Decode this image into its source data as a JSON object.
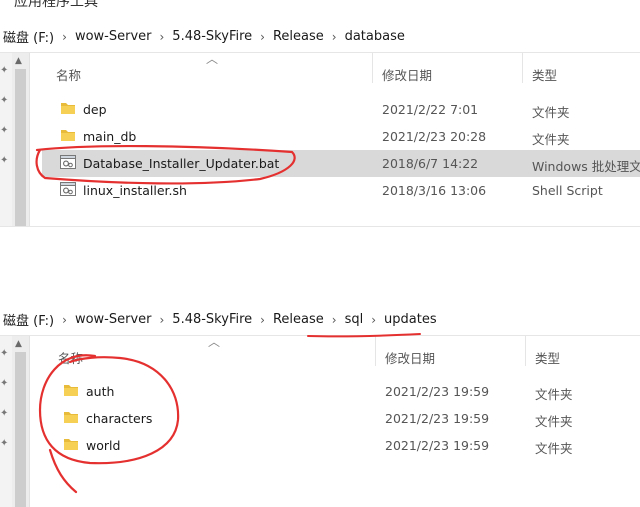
{
  "window_title": "应用程序工具",
  "colors": {
    "folder": "#e8bb3a",
    "selected_row": "#d9d9d9",
    "annotation": "#e53030"
  },
  "top_pane": {
    "breadcrumb": [
      "磁盘 (F:)",
      "wow-Server",
      "5.48-SkyFire",
      "Release",
      "database"
    ],
    "columns": {
      "name": "名称",
      "date": "修改日期",
      "type": "类型"
    },
    "rows": [
      {
        "name": "dep",
        "date": "2021/2/22 7:01",
        "type": "文件夹",
        "icon": "folder-icon"
      },
      {
        "name": "main_db",
        "date": "2021/2/23 20:28",
        "type": "文件夹",
        "icon": "folder-icon"
      },
      {
        "name": "Database_Installer_Updater.bat",
        "date": "2018/6/7 14:22",
        "type": "Windows 批处理文件",
        "icon": "batch-file-icon",
        "selected": true
      },
      {
        "name": "linux_installer.sh",
        "date": "2018/3/16 13:06",
        "type": "Shell Script",
        "icon": "script-file-icon"
      }
    ]
  },
  "bottom_pane": {
    "breadcrumb": [
      "磁盘 (F:)",
      "wow-Server",
      "5.48-SkyFire",
      "Release",
      "sql",
      "updates"
    ],
    "columns": {
      "name": "名称",
      "date": "修改日期",
      "type": "类型"
    },
    "rows": [
      {
        "name": "auth",
        "date": "2021/2/23 19:59",
        "type": "文件夹",
        "icon": "folder-icon"
      },
      {
        "name": "characters",
        "date": "2021/2/23 19:59",
        "type": "文件夹",
        "icon": "folder-icon"
      },
      {
        "name": "world",
        "date": "2021/2/23 19:59",
        "type": "文件夹",
        "icon": "folder-icon"
      }
    ]
  }
}
